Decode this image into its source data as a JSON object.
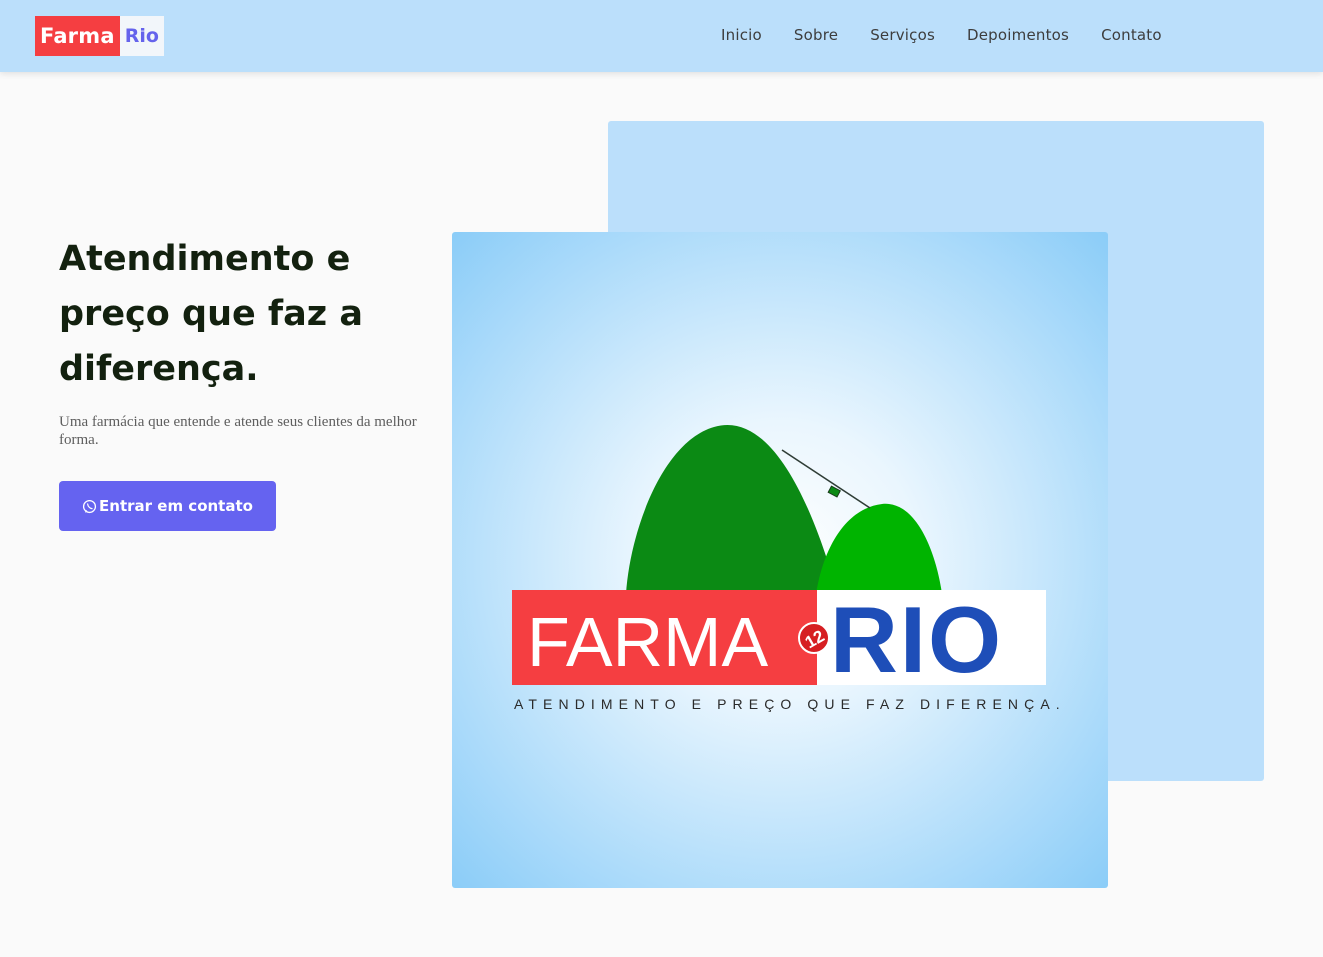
{
  "brand": {
    "part1": "Farma",
    "part2": "Rio"
  },
  "nav": {
    "items": [
      "Inicio",
      "Sobre",
      "Serviços",
      "Depoimentos",
      "Contato"
    ]
  },
  "hero": {
    "title": "Atendimento e preço que faz a diferença.",
    "subtitle": "Uma farmácia que entende e atende seus clientes da melhor forma.",
    "cta_label": "Entrar em contato",
    "cta_icon": "whatsapp-icon"
  },
  "hero_image": {
    "logo_left": "FARMA",
    "logo_badge": "12",
    "logo_right": "RIO",
    "tagline": "ATENDIMENTO E PREÇO QUE FAZ DIFERENÇA."
  },
  "colors": {
    "nav_bg": "#bbdffb",
    "accent": "#6563f0",
    "brand_red": "#f53e41",
    "logo_blue": "#1e4eb8",
    "dark_green": "#0b8a14",
    "light_green": "#00b400",
    "heading": "#13210f"
  }
}
